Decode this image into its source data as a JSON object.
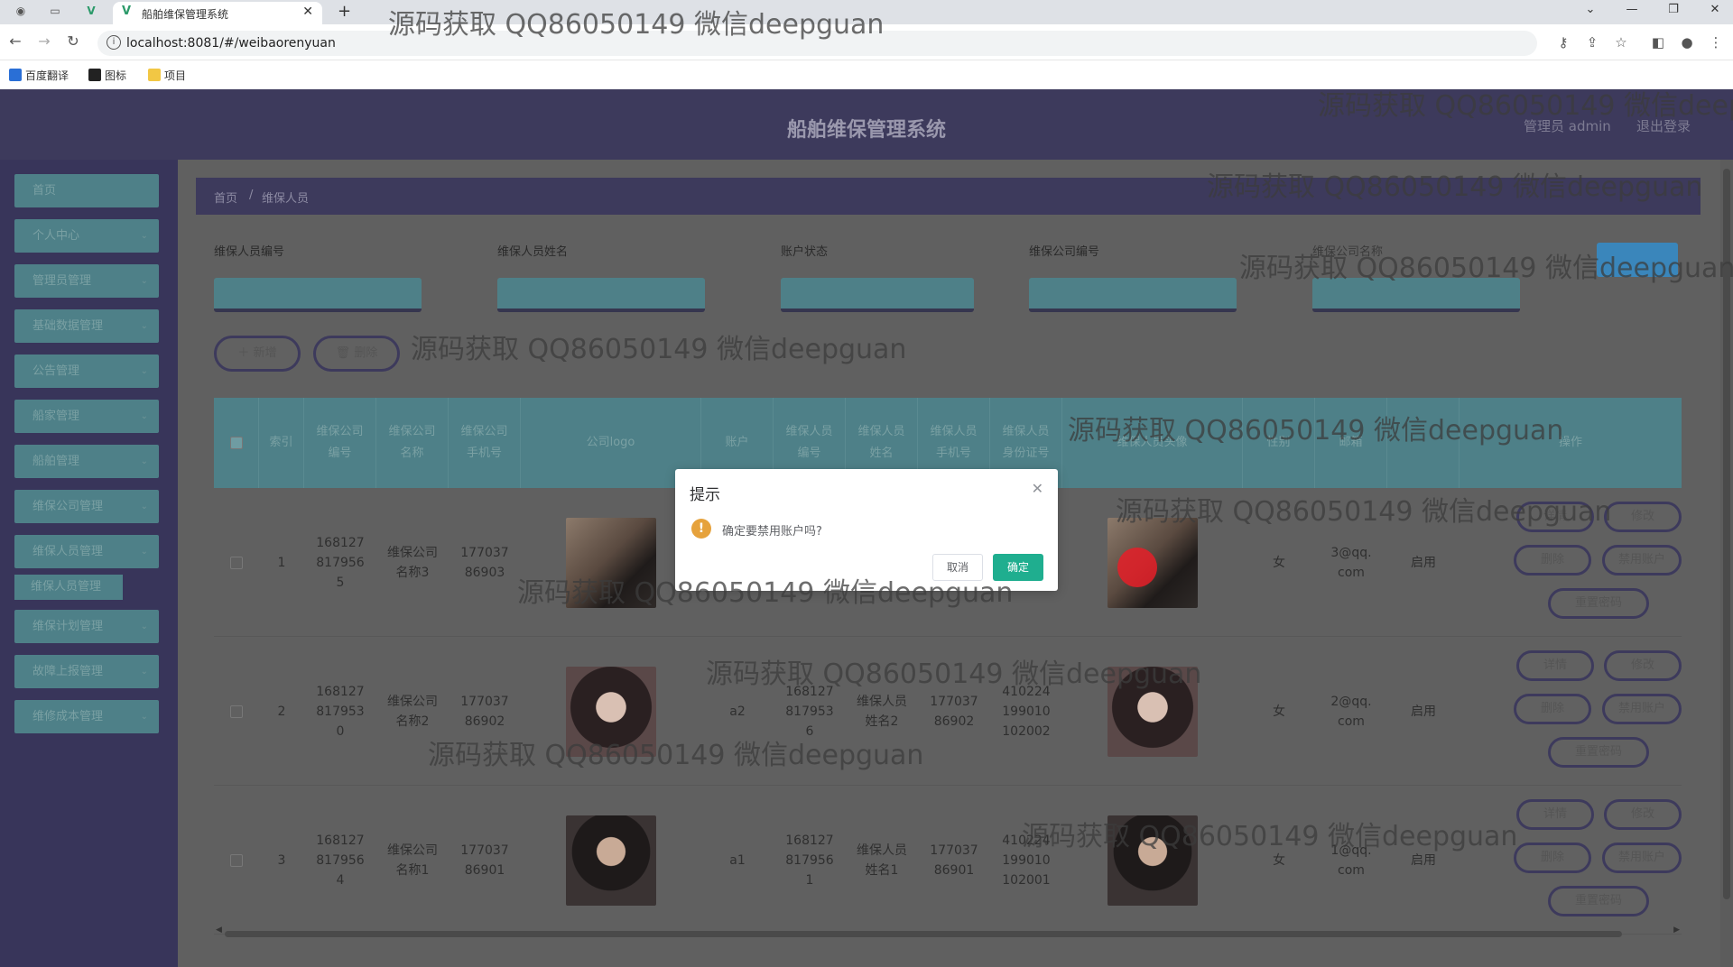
{
  "browser": {
    "tab_title": "船舶维保管理系统",
    "url": "localhost:8081/#/weibaorenyuan",
    "bookmarks": [
      "百度翻译",
      "图标",
      "项目"
    ]
  },
  "app": {
    "title": "船舶维保管理系统",
    "admin_label": "管理员 admin",
    "logout_label": "退出登录"
  },
  "sidebar": {
    "items": [
      {
        "label": "首页",
        "has_chevron": false
      },
      {
        "label": "个人中心",
        "has_chevron": true
      },
      {
        "label": "管理员管理",
        "has_chevron": true
      },
      {
        "label": "基础数据管理",
        "has_chevron": true
      },
      {
        "label": "公告管理",
        "has_chevron": true
      },
      {
        "label": "船家管理",
        "has_chevron": true
      },
      {
        "label": "船舶管理",
        "has_chevron": true
      },
      {
        "label": "维保公司管理",
        "has_chevron": true
      },
      {
        "label": "维保人员管理",
        "has_chevron": true
      }
    ],
    "submenu_item": "维保人员管理",
    "items_after": [
      {
        "label": "维保计划管理"
      },
      {
        "label": "故障上报管理"
      },
      {
        "label": "维修成本管理"
      }
    ]
  },
  "breadcrumb": {
    "home": "首页",
    "separator": "/",
    "current": "维保人员"
  },
  "filters": [
    {
      "label": "维保人员编号"
    },
    {
      "label": "维保人员姓名"
    },
    {
      "label": "账户状态"
    },
    {
      "label": "维保公司编号"
    },
    {
      "label": "维保公司名称"
    }
  ],
  "actions": {
    "add": "新增",
    "delete": "删除"
  },
  "table": {
    "headers": [
      "索引",
      "维保公司编号",
      "维保公司名称",
      "维保公司手机号",
      "公司logo",
      "账户",
      "维保人员编号",
      "维保人员姓名",
      "维保人员手机号",
      "维保人员身份证号",
      "维保人员头像",
      "性别",
      "邮箱",
      "",
      "操作"
    ],
    "rows": [
      {
        "index": "1",
        "company_no": "1681278179565",
        "company_name": "维保公司名称3",
        "company_phone": "17703786903",
        "account": "",
        "staff_no": "",
        "staff_name": "",
        "staff_phone": "",
        "staff_id": "",
        "gender": "女",
        "email": "3@qq.com",
        "status": "启用"
      },
      {
        "index": "2",
        "company_no": "1681278179530",
        "company_name": "维保公司名称2",
        "company_phone": "17703786902",
        "account": "a2",
        "staff_no": "1681278179536",
        "staff_name": "维保人员姓名2",
        "staff_phone": "17703786902",
        "staff_id": "410224199010102002",
        "gender": "女",
        "email": "2@qq.com",
        "status": "启用"
      },
      {
        "index": "3",
        "company_no": "1681278179564",
        "company_name": "维保公司名称1",
        "company_phone": "17703786901",
        "account": "a1",
        "staff_no": "1681278179561",
        "staff_name": "维保人员姓名1",
        "staff_phone": "17703786901",
        "staff_id": "410224199010102001",
        "gender": "女",
        "email": "1@qq.com",
        "status": "启用"
      }
    ],
    "op_labels": {
      "detail": "详情",
      "edit": "修改",
      "delete": "删除",
      "disable": "禁用账户",
      "reset": "重置密码"
    }
  },
  "dialog": {
    "title": "提示",
    "message": "确定要禁用账户吗?",
    "cancel": "取消",
    "confirm": "确定"
  },
  "watermark": "源码获取 QQ86050149 微信deepguan",
  "colors": {
    "header": "#3d3a5c",
    "sidebar_item": "#4e8088",
    "confirm_button": "#1fae8f",
    "warning": "#e6a23c"
  }
}
